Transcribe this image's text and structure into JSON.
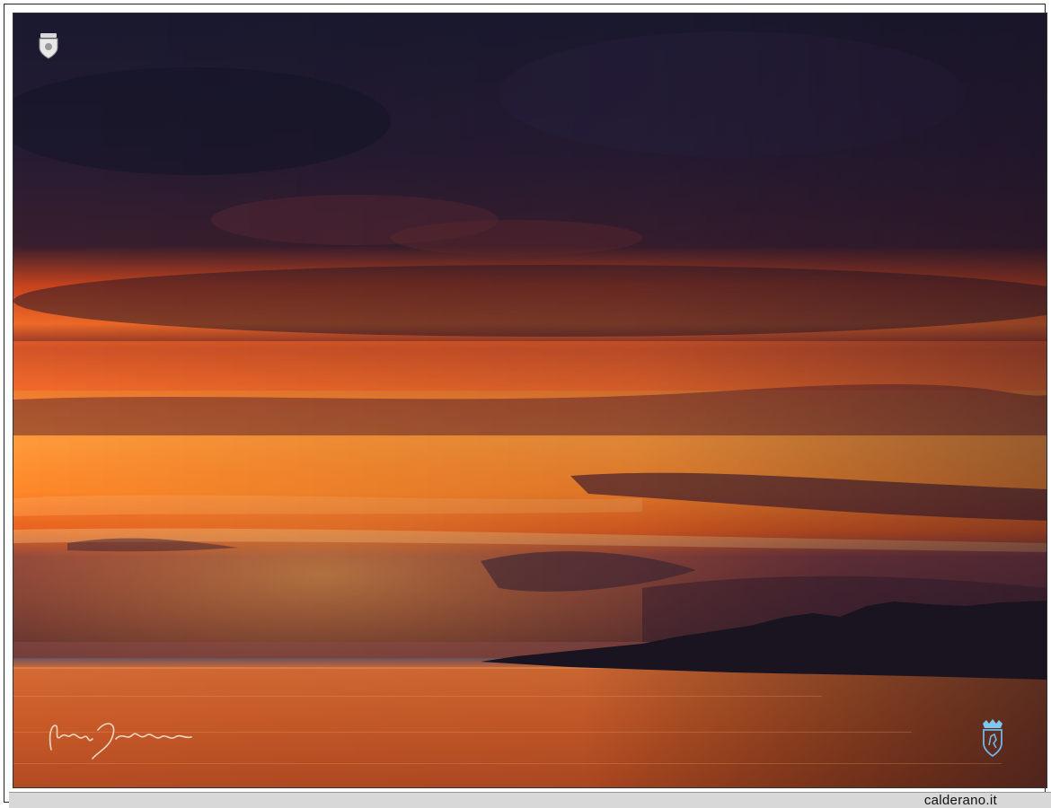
{
  "footer": {
    "site_label": "calderano.it"
  },
  "scene": {
    "description_type": "photograph",
    "sky_colors": {
      "upper": "#1c1a2e",
      "band": "#e85a22",
      "glow": "#ff8a2a",
      "horizon": "#f26a1c"
    },
    "water_color": "#c25a2a",
    "landmass_color": "#1a1320"
  },
  "icons": {
    "top_crest": "crest-emblem-icon",
    "bottom_crest": "coat-of-arms-icon",
    "signature": "handwritten-signature"
  }
}
